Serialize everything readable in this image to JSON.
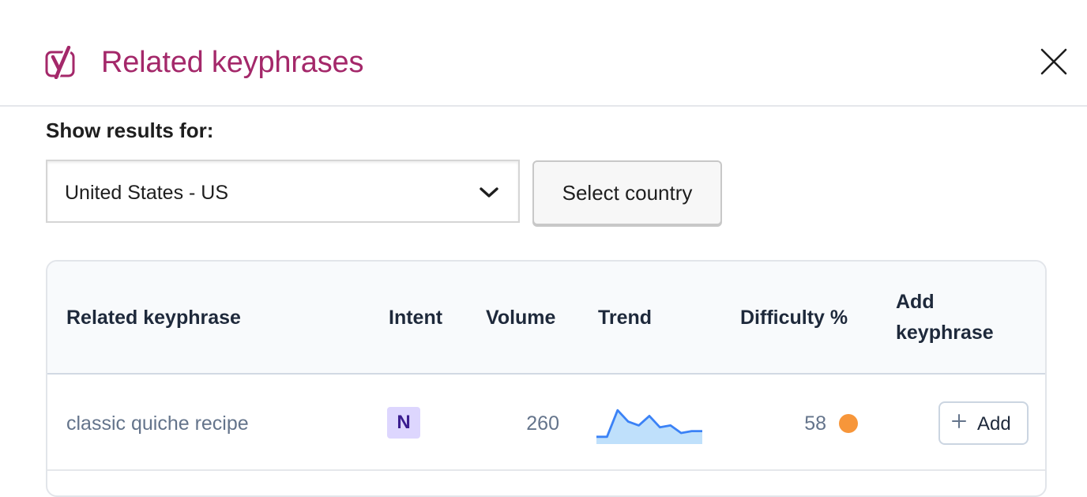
{
  "modal": {
    "title": "Related keyphrases",
    "logo_icon": "yoast-logo-icon",
    "close_icon": "close-icon"
  },
  "filter": {
    "label": "Show results for:",
    "selected_country": "United States - US",
    "select_button_label": "Select country"
  },
  "table": {
    "headers": {
      "keyphrase": "Related keyphrase",
      "intent": "Intent",
      "volume": "Volume",
      "trend": "Trend",
      "difficulty": "Difficulty %",
      "add_line1": "Add",
      "add_line2": "keyphrase"
    },
    "rows": [
      {
        "keyphrase": "classic quiche recipe",
        "intent": "N",
        "volume": "260",
        "trend": [
          0.15,
          0.15,
          0.85,
          0.55,
          0.45,
          0.7,
          0.4,
          0.45,
          0.25,
          0.3,
          0.3
        ],
        "difficulty": "58",
        "difficulty_color": "#f7963a",
        "add_label": "Add"
      }
    ]
  },
  "colors": {
    "brand": "#a4286a",
    "trend_line": "#3b82f6",
    "trend_fill": "#bfe0fb",
    "intent_bg": "#ddd6fe"
  }
}
